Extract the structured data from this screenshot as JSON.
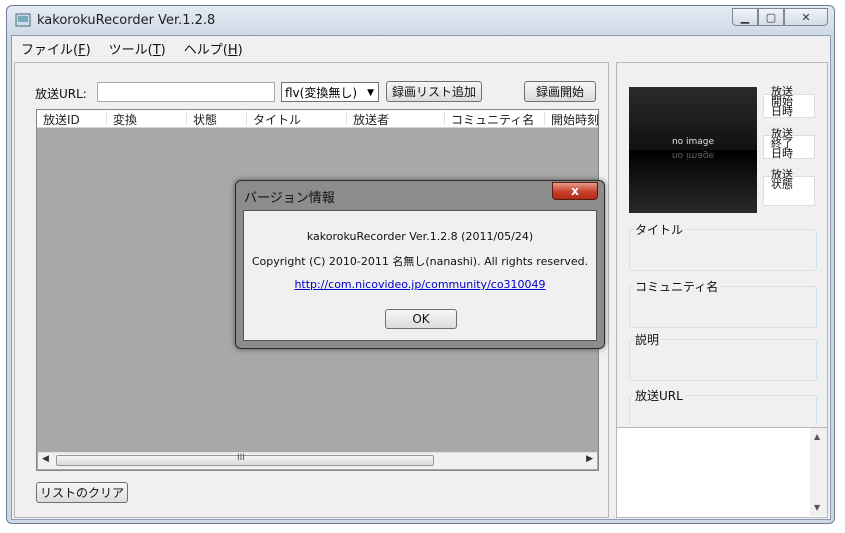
{
  "window": {
    "title": "kakorokuRecorder Ver.1.2.8"
  },
  "menu": [
    {
      "label": "ファイル(",
      "key": "F",
      "tail": ")"
    },
    {
      "label": "ツール(",
      "key": "T",
      "tail": ")"
    },
    {
      "label": "ヘルプ(",
      "key": "H",
      "tail": ")"
    }
  ],
  "left": {
    "url_label": "放送URL:",
    "url_value": "",
    "format_select": "flv(変換無し)",
    "add_list_button": "録画リスト追加",
    "start_button": "録画開始",
    "columns": [
      "放送ID",
      "変換",
      "状態",
      "タイトル",
      "放送者",
      "コミュニティ名",
      "開始時刻"
    ],
    "scroll_label": "III",
    "clear_button": "リストのクリア"
  },
  "right": {
    "thumbnail_text": "no image",
    "broadcast_start_label": "放送開始日時",
    "broadcast_end_label": "放送終了日時",
    "broadcast_status_label": "放送状態",
    "title_group": "タイトル",
    "community_group": "コミュニティ名",
    "description_group": "説明",
    "url_group": "放送URL"
  },
  "dialog": {
    "title": "バージョン情報",
    "close_label": "x",
    "line1": "kakorokuRecorder Ver.1.2.8 (2011/05/24)",
    "line2": "Copyright (C) 2010-2011 名無し(nanashi). All rights reserved.",
    "link": "http://com.nicovideo.jp/community/co310049",
    "ok_button": "OK"
  }
}
